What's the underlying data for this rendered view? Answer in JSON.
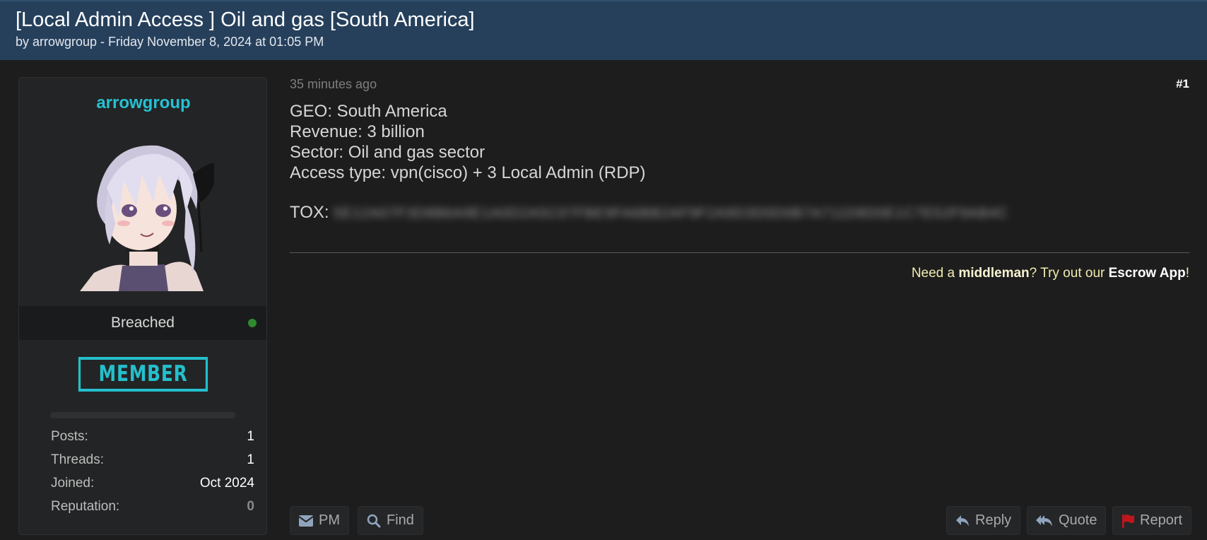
{
  "thread": {
    "title": "[Local Admin Access ] Oil and gas [South America]",
    "meta": "by arrowgroup - Friday November 8, 2024 at 01:05 PM"
  },
  "user": {
    "name": "arrowgroup",
    "avatar_icon": "anime-girl-avatar",
    "status": "Breached",
    "status_color": "#2e8b2e",
    "badge": "MEMBER",
    "stats": [
      {
        "label": "Posts:",
        "value": "1"
      },
      {
        "label": "Threads:",
        "value": "1"
      },
      {
        "label": "Joined:",
        "value": "Oct 2024"
      },
      {
        "label": "Reputation:",
        "value": "0"
      }
    ]
  },
  "post": {
    "time": "35 minutes ago",
    "number": "#1",
    "lines": [
      "GEO: South America",
      "Revenue: 3 billion",
      "Sector: Oil and gas sector",
      "Access type: vpn(cisco) + 3 Local Admin (RDP)"
    ],
    "tox_label": "TOX:",
    "tox_value": "5E12A07F3D8B6A9E1A0D2A5C07FBE9FA6BB2AF9F2A9D3D0D0B7A711D8D0E1C7E52F9AB4C"
  },
  "signature": {
    "pre": "Need a ",
    "bold1": "middleman",
    "mid": "? Try out our ",
    "bold2": "Escrow App",
    "post": "!"
  },
  "actions": {
    "pm": "PM",
    "find": "Find",
    "reply": "Reply",
    "quote": "Quote",
    "report": "Report"
  },
  "colors": {
    "header_bg": "#26405c",
    "accent": "#26c1d2",
    "report_flag": "#c0161b"
  }
}
